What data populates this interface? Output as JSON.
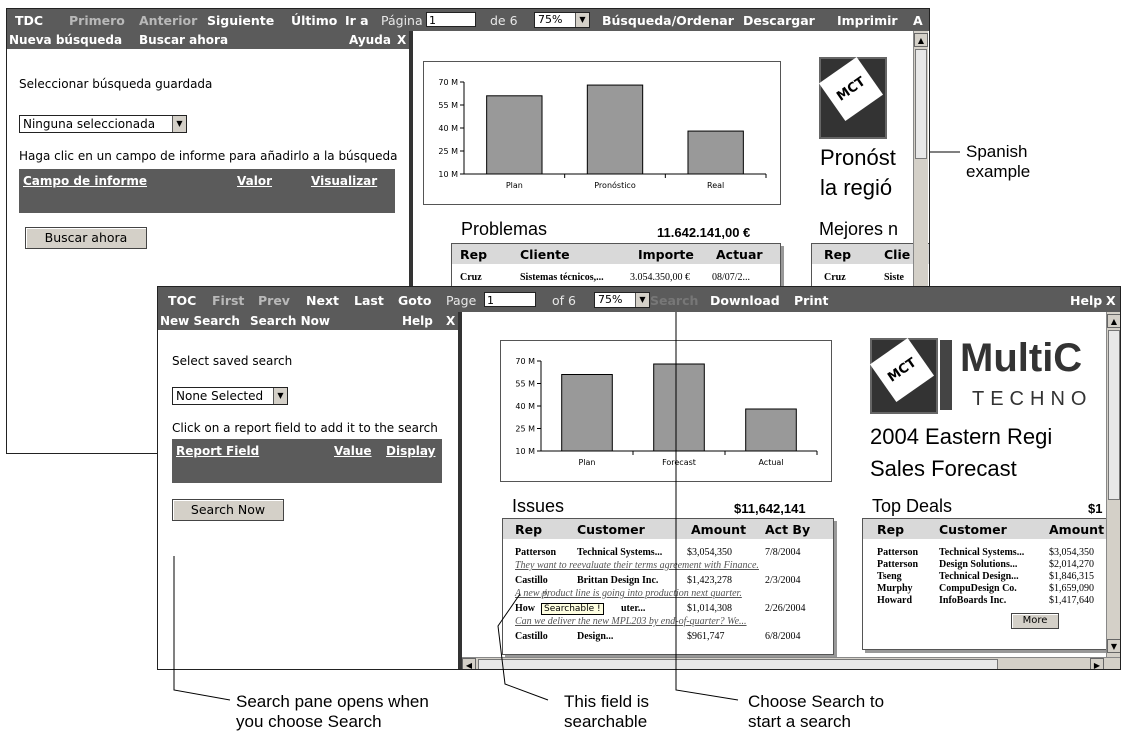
{
  "spanish": {
    "toolbar": {
      "toc": "TDC",
      "first": "Primero",
      "prev": "Anterior",
      "next": "Siguiente",
      "last": "Último",
      "goto": "Ir a",
      "page_label": "Página",
      "page_value": "1",
      "of_pages": "de 6",
      "zoom": "75%",
      "search": "Búsqueda/Ordenar",
      "download": "Descargar",
      "print": "Imprimir",
      "trailing": "A"
    },
    "pane": {
      "new_search": "Nueva búsqueda",
      "search_now": "Buscar ahora",
      "help": "Ayuda",
      "close": "X",
      "saved_label": "Seleccionar búsqueda guardada",
      "saved_value": "Ninguna seleccionada",
      "instructions": "Haga clic en un campo de informe para añadirlo a la búsqueda",
      "col_field": "Campo de informe",
      "col_value": "Valor",
      "col_display": "Visualizar",
      "button": "Buscar ahora"
    },
    "report": {
      "title_line1": "Pronóst",
      "title_line2": "la regió",
      "issues_title": "Problemas",
      "issues_total": "11.642.141,00 €",
      "issues_headers": [
        "Rep",
        "Cliente",
        "Importe",
        "Actuar"
      ],
      "issues_row": {
        "rep": "Cruz",
        "customer": "Sistemas técnicos,...",
        "amount": "3.054.350,00 €",
        "act": "08/07/2..."
      },
      "deals_title": "Mejores n",
      "deals_headers": [
        "Rep",
        "Clie"
      ],
      "deals_row": {
        "rep": "Cruz",
        "customer": "Siste"
      }
    },
    "chart_data": {
      "type": "bar",
      "categories": [
        "Plan",
        "Pronóstico",
        "Real"
      ],
      "values": [
        61,
        68,
        38
      ],
      "ytick_labels": [
        "70 M",
        "55 M",
        "40 M",
        "25 M",
        "10 M"
      ],
      "ylim": [
        10,
        70
      ],
      "grid": false,
      "bar_color": "#999999"
    }
  },
  "english": {
    "toolbar": {
      "toc": "TOC",
      "first": "First",
      "prev": "Prev",
      "next": "Next",
      "last": "Last",
      "goto": "Goto",
      "page_label": "Page",
      "page_value": "1",
      "of_pages": "of 6",
      "zoom": "75%",
      "search": "Search",
      "download": "Download",
      "print": "Print",
      "help": "Help",
      "close": "X"
    },
    "pane": {
      "new_search": "New Search",
      "search_now": "Search Now",
      "help": "Help",
      "close": "X",
      "saved_label": "Select saved search",
      "saved_value": "None Selected",
      "instructions": "Click on a report field to add it to the search",
      "col_field": "Report Field",
      "col_value": "Value",
      "col_display": "Display",
      "button": "Search Now"
    },
    "report": {
      "brand_name": "MultiC",
      "brand_sub": "TECHNO",
      "title_line1": "2004 Eastern Regi",
      "title_line2": "Sales Forecast",
      "issues_title": "Issues",
      "issues_total": "$11,642,141",
      "issues_headers": [
        "Rep",
        "Customer",
        "Amount",
        "Act By"
      ],
      "issues_rows": [
        {
          "rep": "Patterson",
          "customer": "Technical Systems...",
          "amount": "$3,054,350",
          "act": "7/8/2004",
          "note": "They want to reevaluate their terms agreement with Finance."
        },
        {
          "rep": "Castillo",
          "customer": "Brittan Design Inc.",
          "amount": "$1,423,278",
          "act": "2/3/2004",
          "note": "A new product line is going into production next quarter."
        },
        {
          "rep": "Howard",
          "customer": "CompuDesign Co.",
          "amount": "$1,014,308",
          "act": "2/26/2004",
          "note": "Can we deliver the new MPL203 by end-of-quarter? We..."
        },
        {
          "rep": "Castillo",
          "customer": "Design...",
          "amount": "$961,747",
          "act": "6/8/2004",
          "note": ""
        }
      ],
      "issues_rep_partial": "How",
      "issues_customer_partial": "uter...",
      "tooltip": "Searchable !",
      "deals_title": "Top Deals",
      "deals_total": "$1",
      "deals_headers": [
        "Rep",
        "Customer",
        "Amount"
      ],
      "deals_rows": [
        {
          "rep": "Patterson",
          "customer": "Technical Systems...",
          "amount": "$3,054,350"
        },
        {
          "rep": "Patterson",
          "customer": "Design Solutions...",
          "amount": "$2,014,270"
        },
        {
          "rep": "Tseng",
          "customer": "Technical Design...",
          "amount": "$1,846,315"
        },
        {
          "rep": "Murphy",
          "customer": "CompuDesign Co.",
          "amount": "$1,659,090"
        },
        {
          "rep": "Howard",
          "customer": "InfoBoards Inc.",
          "amount": "$1,417,640"
        }
      ],
      "more_button": "More"
    },
    "chart_data": {
      "type": "bar",
      "categories": [
        "Plan",
        "Forecast",
        "Actual"
      ],
      "values": [
        61,
        68,
        38
      ],
      "ytick_labels": [
        "70 M",
        "55 M",
        "40 M",
        "25 M",
        "10 M"
      ],
      "ylim": [
        10,
        70
      ],
      "grid": false,
      "bar_color": "#999999"
    }
  },
  "callouts": {
    "spanish": [
      "Spanish",
      "example"
    ],
    "search_pane": [
      "Search pane opens when",
      "you choose Search"
    ],
    "searchable": [
      "This field is",
      "searchable"
    ],
    "choose_search": [
      "Choose Search to",
      "start a search"
    ]
  }
}
